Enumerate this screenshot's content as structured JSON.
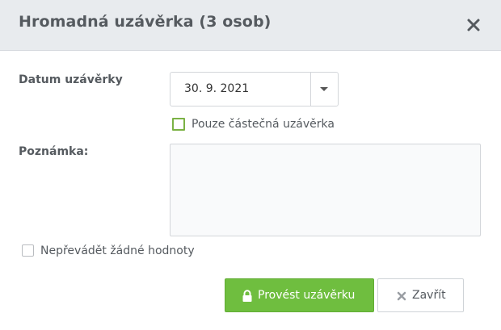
{
  "dialog": {
    "title": "Hromadná uzávěrka (3 osob)",
    "close_icon": "close-icon"
  },
  "form": {
    "date_label": "Datum uzávěrky",
    "date_value": "30. 9. 2021",
    "partial_checkbox_label": "Pouze částečná uzávěrka",
    "partial_checked": false,
    "note_label": "Poznámka:",
    "note_value": "",
    "no_transfer_checkbox_label": "Nepřevádět žádné hodnoty",
    "no_transfer_checked": false
  },
  "footer": {
    "submit_label": "Provést uzávěrku",
    "submit_icon": "lock-icon",
    "close_label": "Zavřít",
    "close_icon": "close-icon"
  },
  "colors": {
    "header_bg": "#e8ebee",
    "primary": "#6fbe3f",
    "checkbox_accent": "#7bb245",
    "text": "#555a5f"
  }
}
